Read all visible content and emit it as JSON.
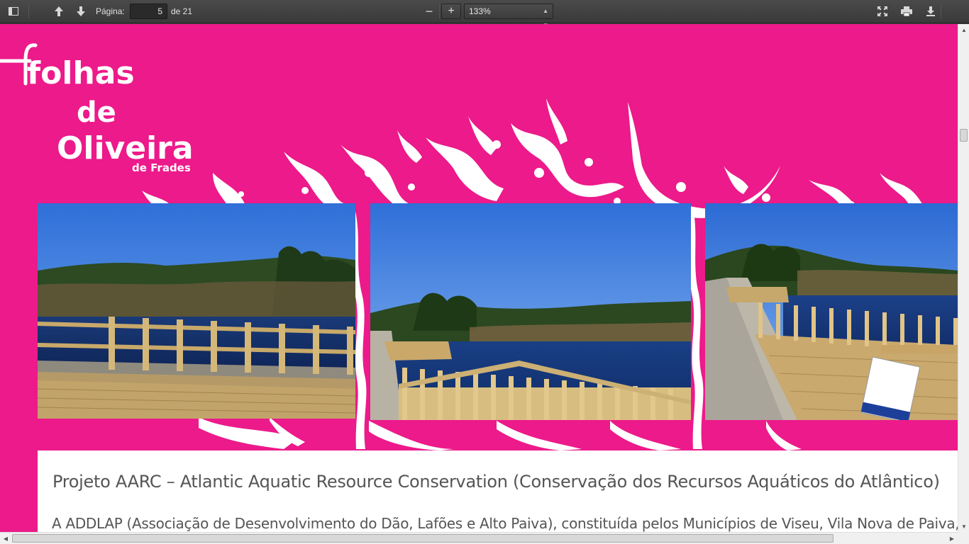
{
  "toolbar": {
    "page_label": "Página:",
    "page_value": "5",
    "page_total": "de 21",
    "zoom_value": "133%",
    "zoom_out_glyph": "−",
    "zoom_in_glyph": "+"
  },
  "icons": {
    "sidebar_toggle": "sidebar-toggle-icon",
    "prev_page": "arrow-up-icon",
    "next_page": "arrow-down-icon",
    "fullscreen": "fullscreen-icon",
    "print": "print-icon",
    "download": "download-icon"
  },
  "logo": {
    "line1": "folhas",
    "line2": "de",
    "line3": "Oliveira",
    "line4": "de Frades"
  },
  "document": {
    "title": "Projeto AARC – Atlantic Aquatic Resource Conservation (Conservação dos Recursos Aquáticos do Atlântico)",
    "body": "A ADDLAP (Associação de Desenvolvimento do Dão, Lafões e Alto Paiva), constituída pelos Municípios de Viseu, Vila Nova de Paiva, Sã"
  },
  "colors": {
    "magenta": "#ec1a8a",
    "toolbar": "#3f3f3f"
  }
}
